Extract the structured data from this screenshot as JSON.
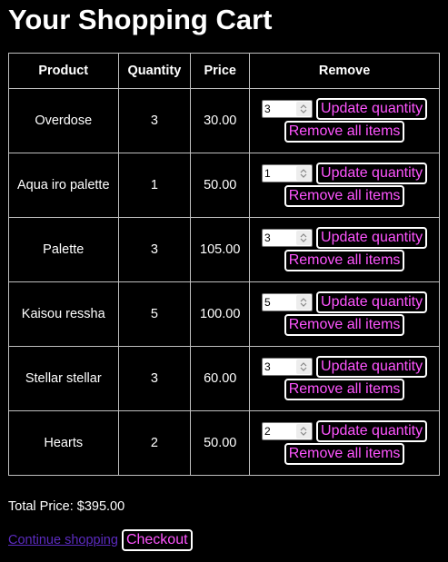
{
  "page": {
    "title": "Your Shopping Cart"
  },
  "table": {
    "headers": {
      "product": "Product",
      "quantity": "Quantity",
      "price": "Price",
      "remove": "Remove"
    },
    "rows": [
      {
        "product": "Overdose",
        "quantity": "3",
        "price": "30.00",
        "input_value": "3"
      },
      {
        "product": "Aqua iro palette",
        "quantity": "1",
        "price": "50.00",
        "input_value": "1"
      },
      {
        "product": "Palette",
        "quantity": "3",
        "price": "105.00",
        "input_value": "3"
      },
      {
        "product": "Kaisou ressha",
        "quantity": "5",
        "price": "100.00",
        "input_value": "5"
      },
      {
        "product": "Stellar stellar",
        "quantity": "3",
        "price": "60.00",
        "input_value": "3"
      },
      {
        "product": "Hearts",
        "quantity": "2",
        "price": "50.00",
        "input_value": "2"
      }
    ],
    "update_label": "Update quantity",
    "remove_label": "Remove all items"
  },
  "summary": {
    "total_text": "Total Price: $395.00"
  },
  "footer": {
    "continue_label": "Continue shopping",
    "checkout_label": "Checkout"
  },
  "colors": {
    "background": "#000000",
    "text": "#ffffff",
    "button_text": "#ff55ff",
    "link": "#5b2bbf"
  }
}
